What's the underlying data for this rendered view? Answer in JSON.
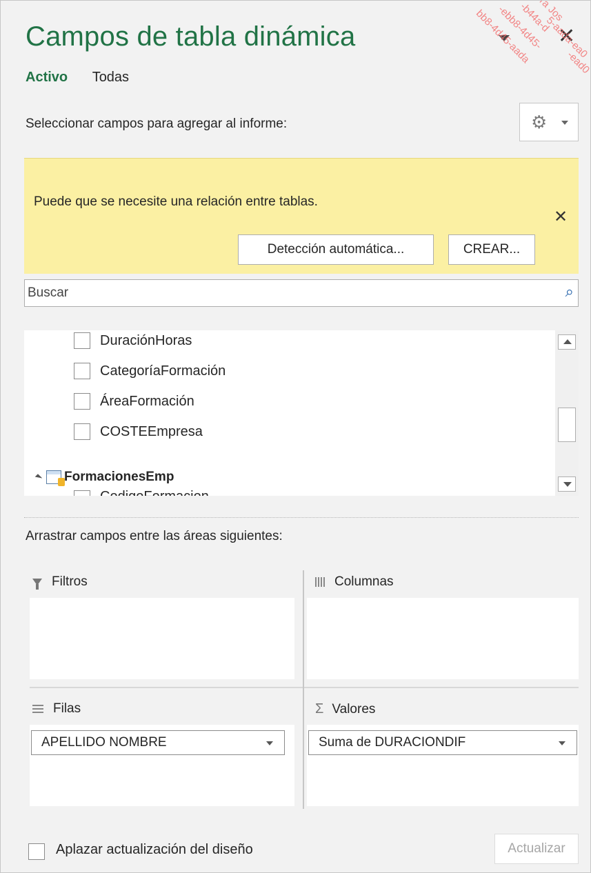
{
  "panel": {
    "title": "Campos de tabla dinámica",
    "tabs": [
      {
        "label": "Activo",
        "active": true
      },
      {
        "label": "Todas",
        "active": false
      }
    ],
    "select_label": "Seleccionar campos para agregar al informe:",
    "tools_icon": "gear-icon"
  },
  "notice": {
    "message": "Puede que se necesite una relación entre tablas.",
    "detect_button": "Detección automática...",
    "create_button": "CREAR..."
  },
  "search": {
    "placeholder": "Buscar"
  },
  "field_list": {
    "fields": [
      {
        "label": "DuraciónHoras",
        "checked": false
      },
      {
        "label": "CategoríaFormación",
        "checked": false
      },
      {
        "label": "ÁreaFormación",
        "checked": false
      },
      {
        "label": "COSTEEmpresa",
        "checked": false
      }
    ],
    "table_name": "FormacionesEmp",
    "partial_field": "CodigoFormacion"
  },
  "areas": {
    "drag_label": "Arrastrar campos entre las áreas siguientes:",
    "filters": {
      "label": "Filtros"
    },
    "columns": {
      "label": "Columnas"
    },
    "rows": {
      "label": "Filas",
      "items": [
        "APELLIDO NOMBRE"
      ]
    },
    "values": {
      "label": "Valores",
      "items": [
        "Suma de DURACIONDIF"
      ]
    }
  },
  "footer": {
    "defer_label": "Aplazar actualización del diseño",
    "update_button": "Actualizar"
  },
  "watermark": [
    "ra Jos",
    "-b44a-d",
    "-ebb8-4d45-",
    "5-aada-ea0",
    "bb8-4d45-aada",
    "-ead0"
  ],
  "colors": {
    "accent": "#217346",
    "notice_bg": "#fbf0a3",
    "panel_bg": "#f2f2f2"
  }
}
